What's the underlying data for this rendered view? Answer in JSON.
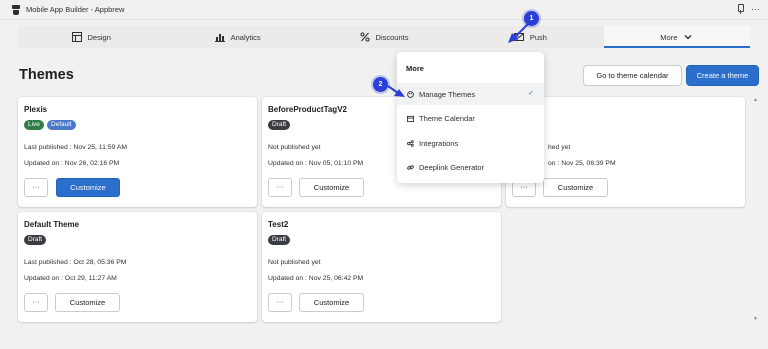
{
  "window": {
    "title": "Mobile App Builder - Appbrew",
    "menu_dots": "···"
  },
  "nav": {
    "tabs": [
      {
        "label": "Design",
        "icon": "layout-icon"
      },
      {
        "label": "Analytics",
        "icon": "bar-chart-icon"
      },
      {
        "label": "Discounts",
        "icon": "percent-icon"
      },
      {
        "label": "Push",
        "icon": "mail-icon"
      },
      {
        "label": "More",
        "icon": "chevron-down-icon",
        "active": true
      }
    ]
  },
  "page": {
    "title": "Themes",
    "calendar_button": "Go to theme calendar",
    "create_button": "Create a theme"
  },
  "cards": [
    {
      "name": "Plexis",
      "badges": [
        "Live",
        "Default"
      ],
      "line1": "Last published : Nov 25, 11:59 AM",
      "line2": "Updated on : Nov 26, 02:16 PM",
      "more": "···",
      "customize": "Customize"
    },
    {
      "name": "BeforeProductTagV2",
      "badges": [
        "Draft"
      ],
      "line1": "Not published yet",
      "line2": "Updated on : Nov 05, 01:10 PM",
      "more": "···",
      "customize": "Customize"
    },
    {
      "name": "",
      "badges": [],
      "line1": "hed yet",
      "line2": "on : Nov 25, 06:39 PM",
      "more": "···",
      "customize": "Customize"
    },
    {
      "name": "Default Theme",
      "badges": [
        "Draft"
      ],
      "line1": "Last published : Oct 28, 05:36 PM",
      "line2": "Updated on : Oct 29, 11:27 AM",
      "more": "···",
      "customize": "Customize"
    },
    {
      "name": "Test2",
      "badges": [
        "Draft"
      ],
      "line1": "Not published yet",
      "line2": "Updated on : Nov 25, 06:42 PM",
      "more": "···",
      "customize": "Customize"
    }
  ],
  "dropdown": {
    "header": "More",
    "items": [
      {
        "label": "Manage Themes",
        "icon": "palette-icon",
        "selected": true,
        "check": "✓"
      },
      {
        "label": "Theme Calendar",
        "icon": "calendar-icon"
      },
      {
        "label": "Integrations",
        "icon": "integrations-icon"
      },
      {
        "label": "Deeplink Generator",
        "icon": "link-icon"
      }
    ]
  },
  "steps": [
    "1",
    "2"
  ],
  "colors": {
    "accent": "#2c6ecb",
    "live": "#2e7d46",
    "default": "#4a79c9",
    "draft": "#3a3d42",
    "step": "#2b3fd6"
  }
}
